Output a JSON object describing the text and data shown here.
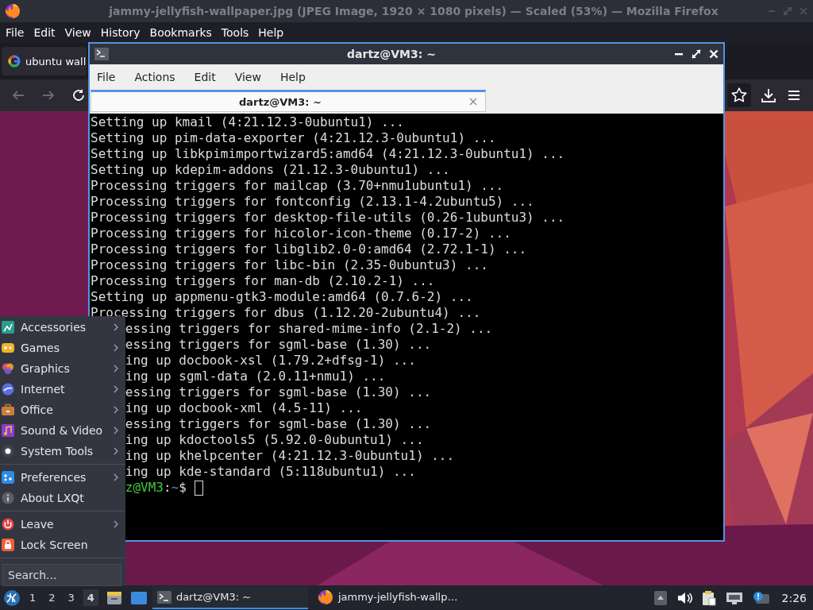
{
  "firefox": {
    "title": "jammy-jellyfish-wallpaper.jpg (JPEG Image, 1920 × 1080 pixels) — Scaled (53%) — Mozilla Firefox",
    "menu": [
      "File",
      "Edit",
      "View",
      "History",
      "Bookmarks",
      "Tools",
      "Help"
    ],
    "tab": {
      "label": "ubuntu wall"
    }
  },
  "terminal": {
    "title": "dartz@VM3: ~",
    "menu": [
      "File",
      "Actions",
      "Edit",
      "View",
      "Help"
    ],
    "tabs": [
      {
        "label": "dartz@VM3: ~",
        "selected": true
      }
    ],
    "lines": [
      {
        "kind": "full",
        "text": "Setting up kmail (4:21.12.3-0ubuntu1) ..."
      },
      {
        "kind": "full",
        "text": "Setting up pim-data-exporter (4:21.12.3-0ubuntu1) ..."
      },
      {
        "kind": "full",
        "text": "Setting up libkpimimportwizard5:amd64 (4:21.12.3-0ubuntu1) ..."
      },
      {
        "kind": "full",
        "text": "Setting up kdepim-addons (21.12.3-0ubuntu1) ..."
      },
      {
        "kind": "full",
        "text": "Processing triggers for mailcap (3.70+nmu1ubuntu1) ..."
      },
      {
        "kind": "full",
        "text": "Processing triggers for fontconfig (2.13.1-4.2ubuntu5) ..."
      },
      {
        "kind": "full",
        "text": "Processing triggers for desktop-file-utils (0.26-1ubuntu3) ..."
      },
      {
        "kind": "full",
        "text": "Processing triggers for hicolor-icon-theme (0.17-2) ..."
      },
      {
        "kind": "full",
        "text": "Processing triggers for libglib2.0-0:amd64 (2.72.1-1) ..."
      },
      {
        "kind": "full",
        "text": "Processing triggers for libc-bin (2.35-0ubuntu3) ..."
      },
      {
        "kind": "full",
        "text": "Processing triggers for man-db (2.10.2-1) ..."
      },
      {
        "kind": "full",
        "text": "Setting up appmenu-gtk3-module:amd64 (0.7.6-2) ..."
      },
      {
        "kind": "full",
        "text": "Processing triggers for dbus (1.12.20-2ubuntu4) ..."
      },
      {
        "kind": "clipped",
        "text": "essing triggers for shared-mime-info (2.1-2) ..."
      },
      {
        "kind": "clipped",
        "text": "essing triggers for sgml-base (1.30) ..."
      },
      {
        "kind": "clipped",
        "text": "ing up docbook-xsl (1.79.2+dfsg-1) ..."
      },
      {
        "kind": "clipped",
        "text": "ing up sgml-data (2.0.11+nmu1) ..."
      },
      {
        "kind": "clipped",
        "text": "essing triggers for sgml-base (1.30) ..."
      },
      {
        "kind": "clipped",
        "text": "ing up docbook-xml (4.5-11) ..."
      },
      {
        "kind": "clipped",
        "text": "essing triggers for sgml-base (1.30) ..."
      },
      {
        "kind": "clipped",
        "text": "ing up kdoctools5 (5.92.0-0ubuntu1) ..."
      },
      {
        "kind": "clipped",
        "text": "ing up khelpcenter (4:21.12.3-0ubuntu1) ..."
      },
      {
        "kind": "clipped",
        "text": "ing up kde-standard (5:118ubuntu1) ..."
      }
    ],
    "prompt": {
      "kind": "clipped",
      "user_host": "z@VM3",
      "separator": ":",
      "path": "~",
      "symbol": "$"
    }
  },
  "app_menu": {
    "sections": [
      [
        {
          "label": "Accessories",
          "submenu": true
        },
        {
          "label": "Games",
          "submenu": true
        },
        {
          "label": "Graphics",
          "submenu": true
        },
        {
          "label": "Internet",
          "submenu": true
        },
        {
          "label": "Office",
          "submenu": true
        },
        {
          "label": "Sound & Video",
          "submenu": true
        },
        {
          "label": "System Tools",
          "submenu": true
        }
      ],
      [
        {
          "label": "Preferences",
          "submenu": true
        },
        {
          "label": "About LXQt",
          "submenu": false
        }
      ],
      [
        {
          "label": "Leave",
          "submenu": true
        },
        {
          "label": "Lock Screen",
          "submenu": false
        }
      ]
    ],
    "search": {
      "placeholder": "Search..."
    }
  },
  "taskbar": {
    "desktops": [
      {
        "label": "1",
        "selected": false
      },
      {
        "label": "2",
        "selected": false
      },
      {
        "label": "3",
        "selected": false
      },
      {
        "label": "4",
        "selected": true
      }
    ],
    "tasks": [
      {
        "kind": "terminal",
        "label": "dartz@VM3: ~",
        "selected": true
      },
      {
        "kind": "browser",
        "label": "jammy-jellyfish-wallp…",
        "selected": false
      }
    ],
    "clock": "2:26"
  }
}
